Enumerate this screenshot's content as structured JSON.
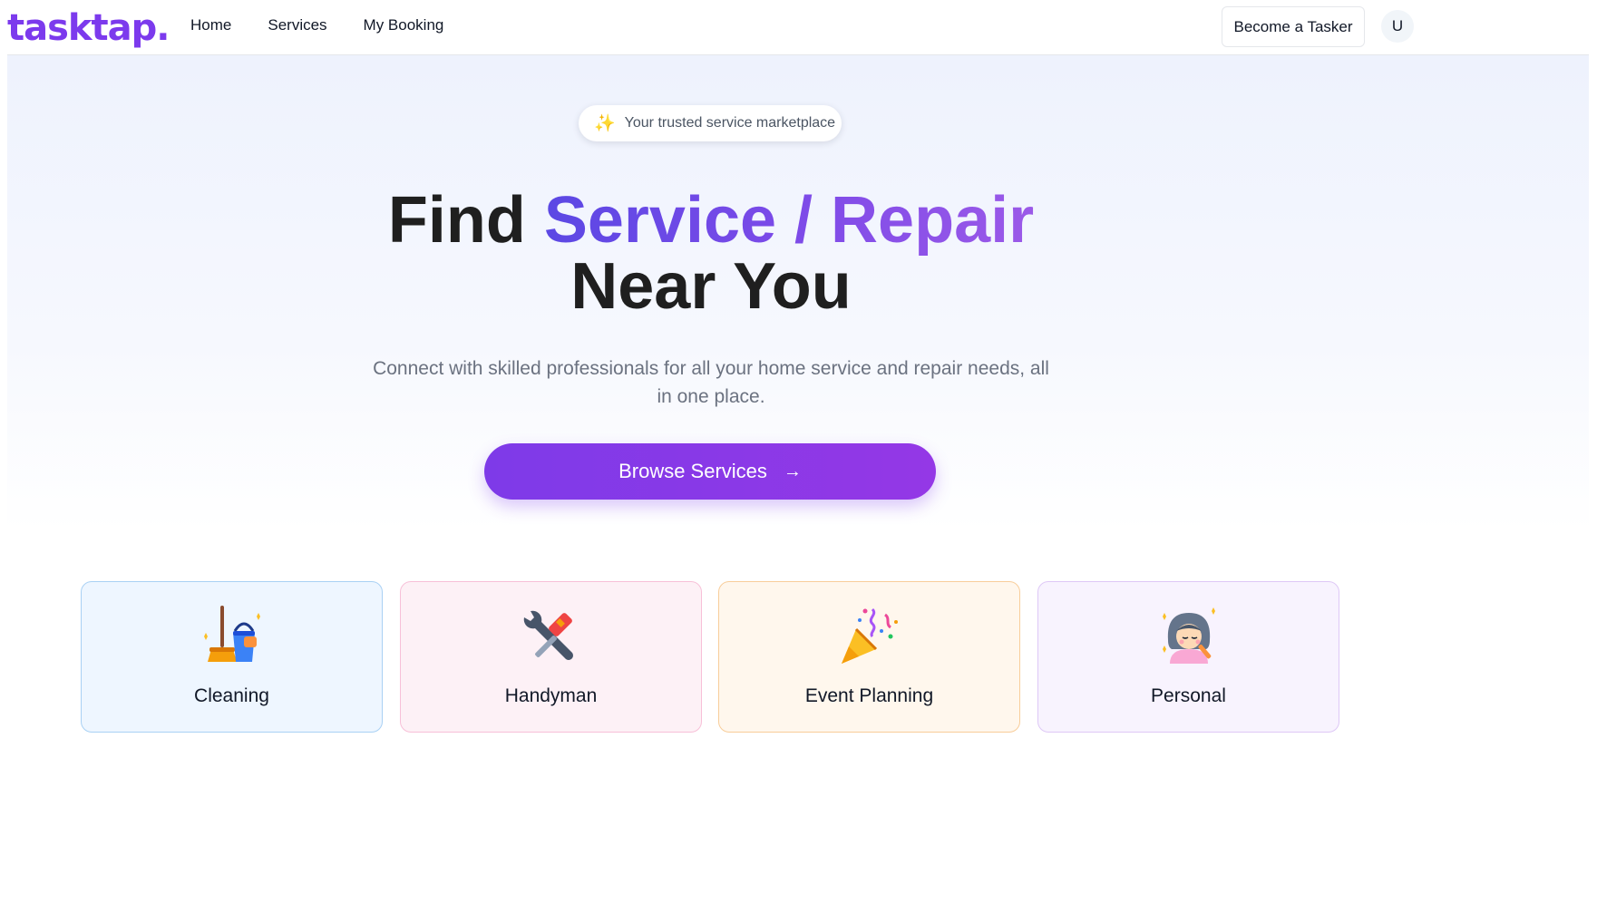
{
  "brand": {
    "logo": "tasktap."
  },
  "nav": {
    "items": [
      "Home",
      "Services",
      "My Booking"
    ]
  },
  "header": {
    "become_tasker": "Become a Tasker",
    "avatar_initial": "U"
  },
  "hero": {
    "badge_text": "Your trusted service marketplace",
    "title_part1": "Find ",
    "title_highlight": "Service / Repair",
    "title_part2": "Near You",
    "subtitle": "Connect with skilled professionals for all your home service and repair needs, all in one place.",
    "cta_label": "Browse Services",
    "cta_icon": "arrow-right-icon"
  },
  "categories": [
    {
      "label": "Cleaning",
      "icon": "broom-bucket-icon"
    },
    {
      "label": "Handyman",
      "icon": "tools-icon"
    },
    {
      "label": "Event Planning",
      "icon": "party-popper-icon"
    },
    {
      "label": "Personal",
      "icon": "beauty-person-icon"
    }
  ],
  "colors": {
    "brand_purple": "#7c3aed",
    "cta_gradient_start": "#7e3ae8",
    "cta_gradient_end": "#9438e6",
    "title_dark": "#1f1f1f"
  }
}
